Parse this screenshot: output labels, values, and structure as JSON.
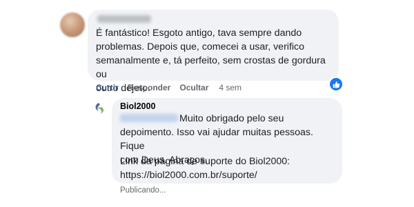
{
  "comment": {
    "author_name": "",
    "text": "É fantástico! Esgoto antigo, tava sempre dando\nproblemas. Depois que, comecei a usar, verifico\nsemanalmente e, tá perfeito, sem crostas de gordura ou\noutro dejeto.",
    "actions": {
      "like": "Curtir",
      "reply": "Responder",
      "hide": "Ocultar",
      "time": "4 sem"
    },
    "reaction_icon": "thumbs-up-icon",
    "reaction_color": "#1877f2"
  },
  "reply": {
    "author": "Biol2000",
    "text_main": "Muito obrigado pelo seu\ndepoimento. Isso vai ajudar muitas pessoas. Fique\ncom Deus. Abraços.",
    "text_link": "Link da página de suporte do Biol2000:\nhttps://biol2000.com.br/suporte/",
    "status": "Publicando..."
  },
  "colors": {
    "bubble": "#f0f2f5",
    "meta_text": "#65676b",
    "link_action": "#385898"
  }
}
